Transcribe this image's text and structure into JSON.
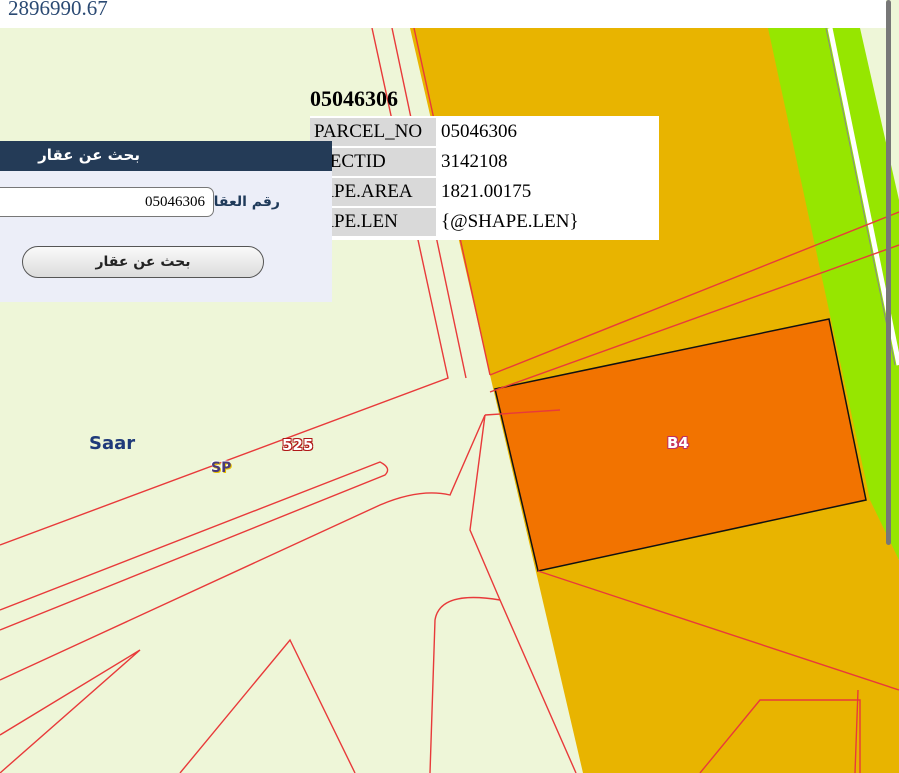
{
  "coordinate_readout": "2896990.67",
  "map": {
    "colors": {
      "background": "#eef6d8",
      "zone_orange": "#e8b400",
      "zone_green": "#96e600",
      "parcel_fill": "#f27300",
      "parcel_outline": "#111111",
      "boundary_lines": "#e83a3a"
    },
    "labels": {
      "saar": "Saar",
      "sp": "SP",
      "zone_525": "525",
      "parcel_b4": "B4"
    }
  },
  "info_popup": {
    "title": "05046306",
    "rows": [
      {
        "key": "PARCEL_NO",
        "value": "05046306"
      },
      {
        "key": "OBJECTID",
        "value": "3142108"
      },
      {
        "key": "SHAPE.AREA",
        "value": "1821.00175"
      },
      {
        "key": "SHAPE.LEN",
        "value": "{@SHAPE.LEN}"
      }
    ]
  },
  "search_panel": {
    "header": "بحث عن عقار",
    "field_label": "رقم العقار",
    "field_value": "05046306",
    "button_label": "بحث عن عقار"
  }
}
